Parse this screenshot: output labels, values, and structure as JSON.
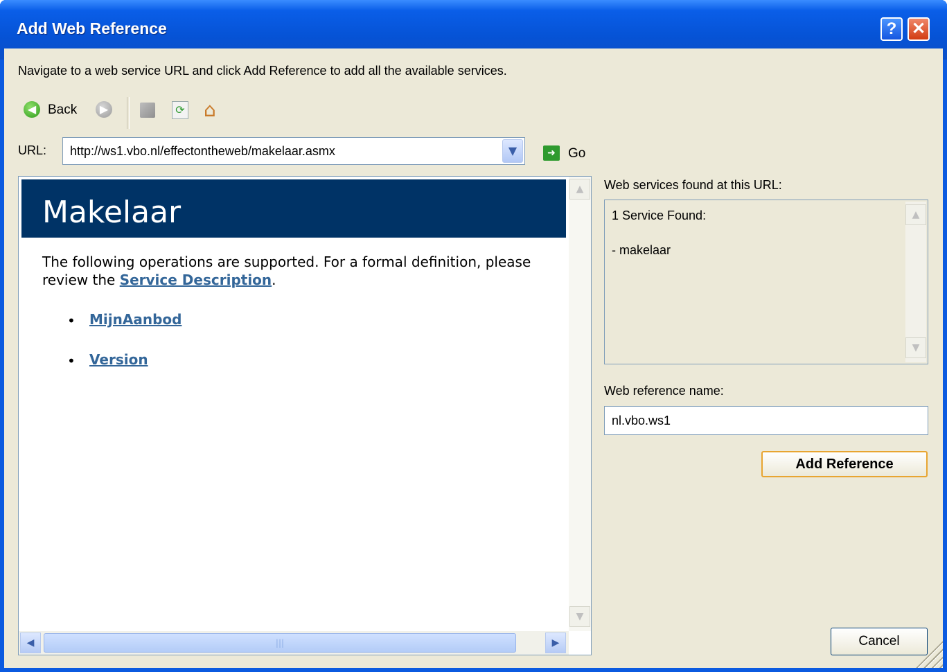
{
  "window": {
    "title": "Add Web Reference",
    "help_glyph": "?",
    "close_glyph": "✕"
  },
  "instruction": "Navigate to a web service URL and click Add Reference to add all the available services.",
  "toolbar": {
    "back_label": "Back"
  },
  "url": {
    "label": "URL:",
    "value": "http://ws1.vbo.nl/effectontheweb/makelaar.asmx",
    "go_label": "Go"
  },
  "browser_page": {
    "title": "Makelaar",
    "intro_before": "The following operations are supported. For a formal definition, please review the ",
    "intro_link": "Service Description",
    "intro_after": ".",
    "operations": [
      "MijnAanbod",
      "Version"
    ]
  },
  "services": {
    "label": "Web services found at this URL:",
    "count_text": "1 Service Found:",
    "items": [
      "- makelaar"
    ]
  },
  "reference": {
    "label": "Web reference name:",
    "value": "nl.vbo.ws1",
    "add_button": "Add Reference",
    "cancel_button": "Cancel"
  },
  "colors": {
    "title_bar": "#0653d6",
    "dialog_bg": "#ece9d8",
    "page_banner": "#003366",
    "link": "#336699",
    "default_button_border": "#e8a531"
  }
}
